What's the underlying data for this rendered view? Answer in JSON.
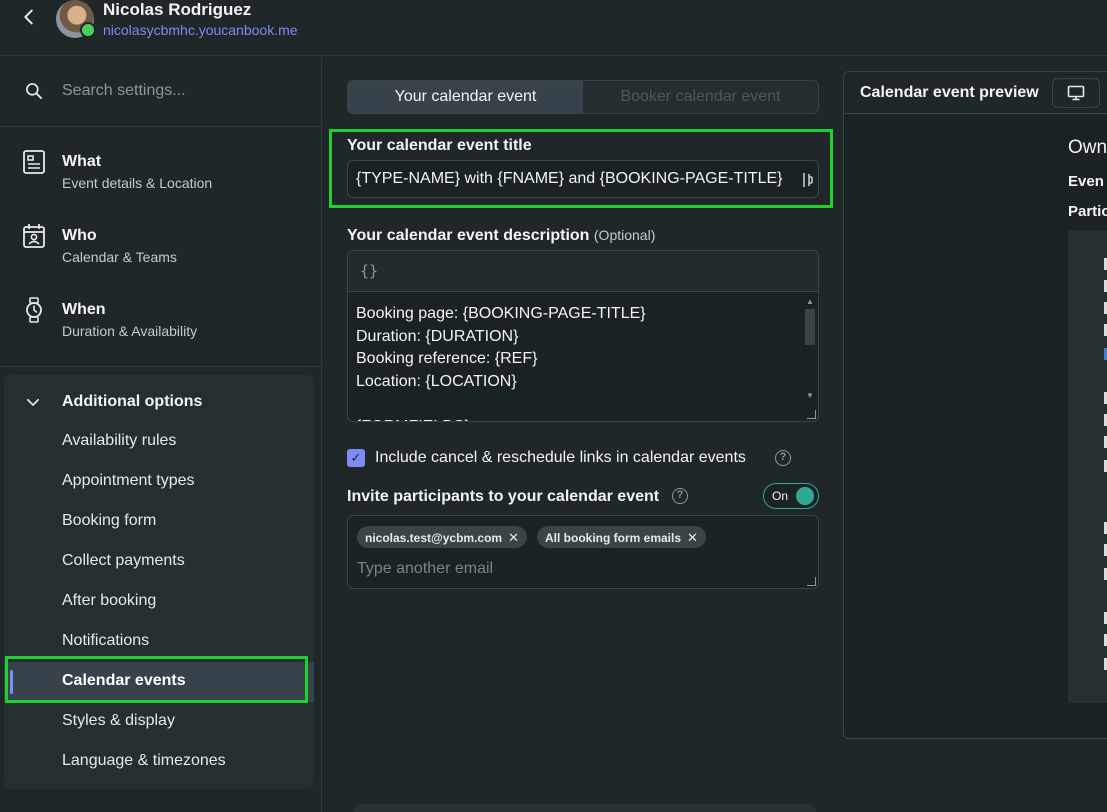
{
  "header": {
    "user_name": "Nicolas Rodriguez",
    "user_url": "nicolasycbmhc.youcanbook.me"
  },
  "sidebar": {
    "search_placeholder": "Search settings...",
    "main_items": [
      {
        "title": "What",
        "subtitle": "Event details & Location",
        "icon": "document-icon"
      },
      {
        "title": "Who",
        "subtitle": "Calendar & Teams",
        "icon": "calendar-person-icon"
      },
      {
        "title": "When",
        "subtitle": "Duration & Availability",
        "icon": "watch-icon"
      }
    ],
    "additional_title": "Additional options",
    "sub_items": [
      "Availability rules",
      "Appointment types",
      "Booking form",
      "Collect payments",
      "After booking",
      "Notifications",
      "Calendar events",
      "Styles & display",
      "Language & timezones"
    ],
    "active_item": "Calendar events"
  },
  "tabs": {
    "your_event": "Your calendar event",
    "booker_event": "Booker calendar event"
  },
  "form": {
    "title_label": "Your calendar event title",
    "title_value": "{TYPE-NAME} with {FNAME} and {BOOKING-PAGE-TITLE}",
    "desc_label": "Your calendar event description",
    "desc_optional": "(Optional)",
    "desc_toolbar_icon": "{}",
    "desc_text": "Booking page: {BOOKING-PAGE-TITLE}\nDuration: {DURATION}\nBooking reference: {REF}\nLocation: {LOCATION}\n\n{FORMFIELDS}",
    "cancel_links_label": "Include cancel & reschedule links in calendar events",
    "cancel_links_checked": true,
    "invite_label": "Invite participants to your calendar event",
    "invite_toggle": "On",
    "chips": [
      "nicolas.test@ycbm.com",
      "All booking form emails"
    ],
    "invite_placeholder": "Type another email"
  },
  "preview": {
    "title": "Calendar event preview",
    "owner_fragment": "Own",
    "event_fragment": "Even",
    "participants_fragment": "Partic"
  },
  "colors": {
    "accent": "#7f8cf5",
    "highlight": "#1fd12f",
    "toggle": "#2fa996",
    "background": "#1f2729"
  }
}
